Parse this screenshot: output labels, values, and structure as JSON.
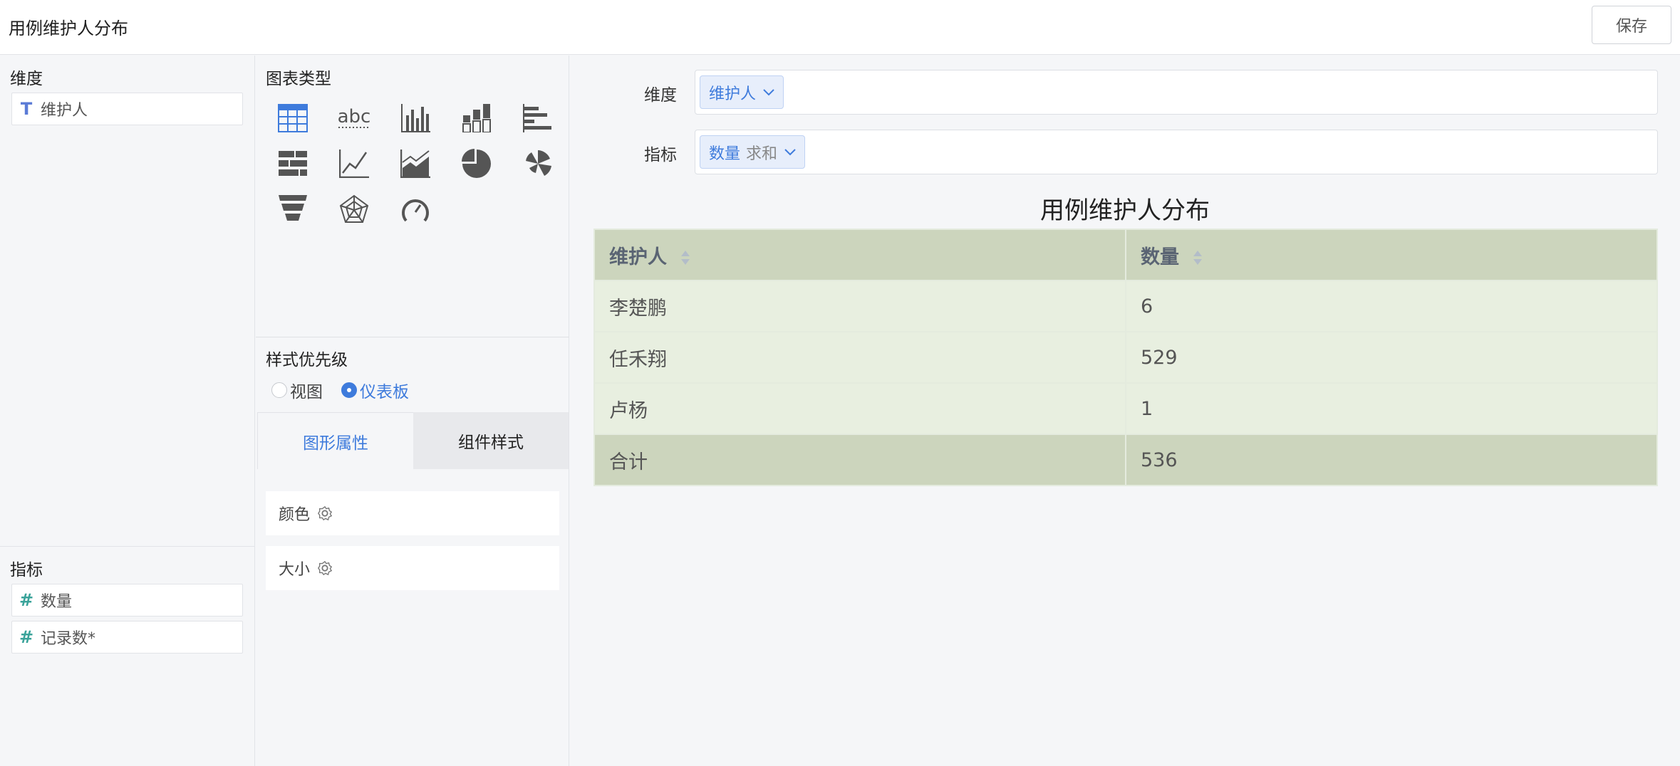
{
  "header": {
    "title": "用例维护人分布",
    "save_label": "保存"
  },
  "left_panel": {
    "dimensions_title": "维度",
    "dimensions": [
      {
        "icon": "T",
        "label": "维护人"
      }
    ],
    "metrics_title": "指标",
    "metrics": [
      {
        "icon": "#",
        "label": "数量"
      },
      {
        "icon": "#",
        "label": "记录数*"
      }
    ]
  },
  "chart_panel": {
    "chart_types_title": "图表类型",
    "chart_types": [
      "table-icon",
      "text-icon",
      "bar-chart-icon",
      "stacked-bar-icon",
      "horizontal-bar-icon",
      "stacked-horizontal-bar-icon",
      "line-chart-icon",
      "area-chart-icon",
      "pie-chart-icon",
      "rose-chart-icon",
      "funnel-icon",
      "radar-icon",
      "gauge-icon"
    ],
    "text_icon_label": "abc",
    "style_priority_title": "样式优先级",
    "radio_view": "视图",
    "radio_dashboard": "仪表板",
    "tab_graphic": "图形属性",
    "tab_component": "组件样式",
    "prop_color": "颜色",
    "prop_size": "大小",
    "accent": "#3e7bdc"
  },
  "main": {
    "dimension_label": "维度",
    "dimension_pill": "维护人",
    "metric_label": "指标",
    "metric_pill": "数量",
    "metric_agg": "求和",
    "table_title": "用例维护人分布",
    "columns": [
      "维护人",
      "数量"
    ],
    "rows": [
      [
        "李楚鹏",
        "6"
      ],
      [
        "任禾翔",
        "529"
      ],
      [
        "卢杨",
        "1"
      ]
    ],
    "total": [
      "合计",
      "536"
    ],
    "header_color": "#ccd5bd",
    "cell_color": "#e8efe0"
  }
}
